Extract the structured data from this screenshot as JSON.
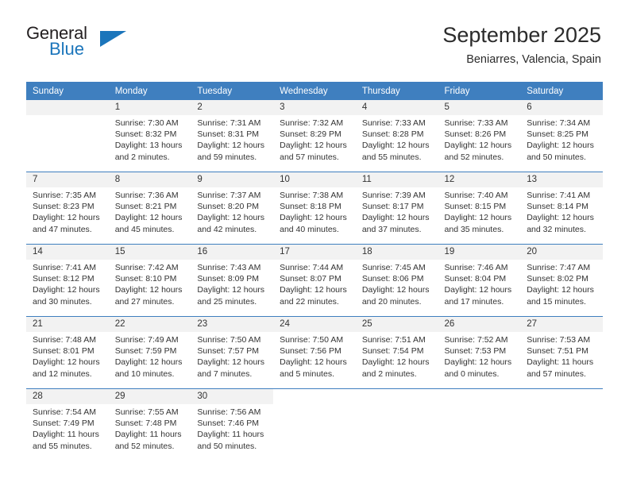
{
  "brand": {
    "name_part1": "General",
    "name_part2": "Blue"
  },
  "header": {
    "title": "September 2025",
    "subtitle": "Beniarres, Valencia, Spain"
  },
  "colors": {
    "header_blue": "#3f7fbf",
    "brand_blue": "#1b75bb",
    "daynum_band": "#f2f2f2"
  },
  "calendar": {
    "weekdays": [
      "Sunday",
      "Monday",
      "Tuesday",
      "Wednesday",
      "Thursday",
      "Friday",
      "Saturday"
    ],
    "weeks": [
      [
        {
          "day": "",
          "sunrise": "",
          "sunset": "",
          "daylight1": "",
          "daylight2": "",
          "empty": true
        },
        {
          "day": "1",
          "sunrise": "Sunrise: 7:30 AM",
          "sunset": "Sunset: 8:32 PM",
          "daylight1": "Daylight: 13 hours",
          "daylight2": "and 2 minutes."
        },
        {
          "day": "2",
          "sunrise": "Sunrise: 7:31 AM",
          "sunset": "Sunset: 8:31 PM",
          "daylight1": "Daylight: 12 hours",
          "daylight2": "and 59 minutes."
        },
        {
          "day": "3",
          "sunrise": "Sunrise: 7:32 AM",
          "sunset": "Sunset: 8:29 PM",
          "daylight1": "Daylight: 12 hours",
          "daylight2": "and 57 minutes."
        },
        {
          "day": "4",
          "sunrise": "Sunrise: 7:33 AM",
          "sunset": "Sunset: 8:28 PM",
          "daylight1": "Daylight: 12 hours",
          "daylight2": "and 55 minutes."
        },
        {
          "day": "5",
          "sunrise": "Sunrise: 7:33 AM",
          "sunset": "Sunset: 8:26 PM",
          "daylight1": "Daylight: 12 hours",
          "daylight2": "and 52 minutes."
        },
        {
          "day": "6",
          "sunrise": "Sunrise: 7:34 AM",
          "sunset": "Sunset: 8:25 PM",
          "daylight1": "Daylight: 12 hours",
          "daylight2": "and 50 minutes."
        }
      ],
      [
        {
          "day": "7",
          "sunrise": "Sunrise: 7:35 AM",
          "sunset": "Sunset: 8:23 PM",
          "daylight1": "Daylight: 12 hours",
          "daylight2": "and 47 minutes."
        },
        {
          "day": "8",
          "sunrise": "Sunrise: 7:36 AM",
          "sunset": "Sunset: 8:21 PM",
          "daylight1": "Daylight: 12 hours",
          "daylight2": "and 45 minutes."
        },
        {
          "day": "9",
          "sunrise": "Sunrise: 7:37 AM",
          "sunset": "Sunset: 8:20 PM",
          "daylight1": "Daylight: 12 hours",
          "daylight2": "and 42 minutes."
        },
        {
          "day": "10",
          "sunrise": "Sunrise: 7:38 AM",
          "sunset": "Sunset: 8:18 PM",
          "daylight1": "Daylight: 12 hours",
          "daylight2": "and 40 minutes."
        },
        {
          "day": "11",
          "sunrise": "Sunrise: 7:39 AM",
          "sunset": "Sunset: 8:17 PM",
          "daylight1": "Daylight: 12 hours",
          "daylight2": "and 37 minutes."
        },
        {
          "day": "12",
          "sunrise": "Sunrise: 7:40 AM",
          "sunset": "Sunset: 8:15 PM",
          "daylight1": "Daylight: 12 hours",
          "daylight2": "and 35 minutes."
        },
        {
          "day": "13",
          "sunrise": "Sunrise: 7:41 AM",
          "sunset": "Sunset: 8:14 PM",
          "daylight1": "Daylight: 12 hours",
          "daylight2": "and 32 minutes."
        }
      ],
      [
        {
          "day": "14",
          "sunrise": "Sunrise: 7:41 AM",
          "sunset": "Sunset: 8:12 PM",
          "daylight1": "Daylight: 12 hours",
          "daylight2": "and 30 minutes."
        },
        {
          "day": "15",
          "sunrise": "Sunrise: 7:42 AM",
          "sunset": "Sunset: 8:10 PM",
          "daylight1": "Daylight: 12 hours",
          "daylight2": "and 27 minutes."
        },
        {
          "day": "16",
          "sunrise": "Sunrise: 7:43 AM",
          "sunset": "Sunset: 8:09 PM",
          "daylight1": "Daylight: 12 hours",
          "daylight2": "and 25 minutes."
        },
        {
          "day": "17",
          "sunrise": "Sunrise: 7:44 AM",
          "sunset": "Sunset: 8:07 PM",
          "daylight1": "Daylight: 12 hours",
          "daylight2": "and 22 minutes."
        },
        {
          "day": "18",
          "sunrise": "Sunrise: 7:45 AM",
          "sunset": "Sunset: 8:06 PM",
          "daylight1": "Daylight: 12 hours",
          "daylight2": "and 20 minutes."
        },
        {
          "day": "19",
          "sunrise": "Sunrise: 7:46 AM",
          "sunset": "Sunset: 8:04 PM",
          "daylight1": "Daylight: 12 hours",
          "daylight2": "and 17 minutes."
        },
        {
          "day": "20",
          "sunrise": "Sunrise: 7:47 AM",
          "sunset": "Sunset: 8:02 PM",
          "daylight1": "Daylight: 12 hours",
          "daylight2": "and 15 minutes."
        }
      ],
      [
        {
          "day": "21",
          "sunrise": "Sunrise: 7:48 AM",
          "sunset": "Sunset: 8:01 PM",
          "daylight1": "Daylight: 12 hours",
          "daylight2": "and 12 minutes."
        },
        {
          "day": "22",
          "sunrise": "Sunrise: 7:49 AM",
          "sunset": "Sunset: 7:59 PM",
          "daylight1": "Daylight: 12 hours",
          "daylight2": "and 10 minutes."
        },
        {
          "day": "23",
          "sunrise": "Sunrise: 7:50 AM",
          "sunset": "Sunset: 7:57 PM",
          "daylight1": "Daylight: 12 hours",
          "daylight2": "and 7 minutes."
        },
        {
          "day": "24",
          "sunrise": "Sunrise: 7:50 AM",
          "sunset": "Sunset: 7:56 PM",
          "daylight1": "Daylight: 12 hours",
          "daylight2": "and 5 minutes."
        },
        {
          "day": "25",
          "sunrise": "Sunrise: 7:51 AM",
          "sunset": "Sunset: 7:54 PM",
          "daylight1": "Daylight: 12 hours",
          "daylight2": "and 2 minutes."
        },
        {
          "day": "26",
          "sunrise": "Sunrise: 7:52 AM",
          "sunset": "Sunset: 7:53 PM",
          "daylight1": "Daylight: 12 hours",
          "daylight2": "and 0 minutes."
        },
        {
          "day": "27",
          "sunrise": "Sunrise: 7:53 AM",
          "sunset": "Sunset: 7:51 PM",
          "daylight1": "Daylight: 11 hours",
          "daylight2": "and 57 minutes."
        }
      ],
      [
        {
          "day": "28",
          "sunrise": "Sunrise: 7:54 AM",
          "sunset": "Sunset: 7:49 PM",
          "daylight1": "Daylight: 11 hours",
          "daylight2": "and 55 minutes."
        },
        {
          "day": "29",
          "sunrise": "Sunrise: 7:55 AM",
          "sunset": "Sunset: 7:48 PM",
          "daylight1": "Daylight: 11 hours",
          "daylight2": "and 52 minutes."
        },
        {
          "day": "30",
          "sunrise": "Sunrise: 7:56 AM",
          "sunset": "Sunset: 7:46 PM",
          "daylight1": "Daylight: 11 hours",
          "daylight2": "and 50 minutes."
        },
        {
          "day": "",
          "sunrise": "",
          "sunset": "",
          "daylight1": "",
          "daylight2": "",
          "blank": true
        },
        {
          "day": "",
          "sunrise": "",
          "sunset": "",
          "daylight1": "",
          "daylight2": "",
          "blank": true
        },
        {
          "day": "",
          "sunrise": "",
          "sunset": "",
          "daylight1": "",
          "daylight2": "",
          "blank": true
        },
        {
          "day": "",
          "sunrise": "",
          "sunset": "",
          "daylight1": "",
          "daylight2": "",
          "blank": true
        }
      ]
    ]
  }
}
